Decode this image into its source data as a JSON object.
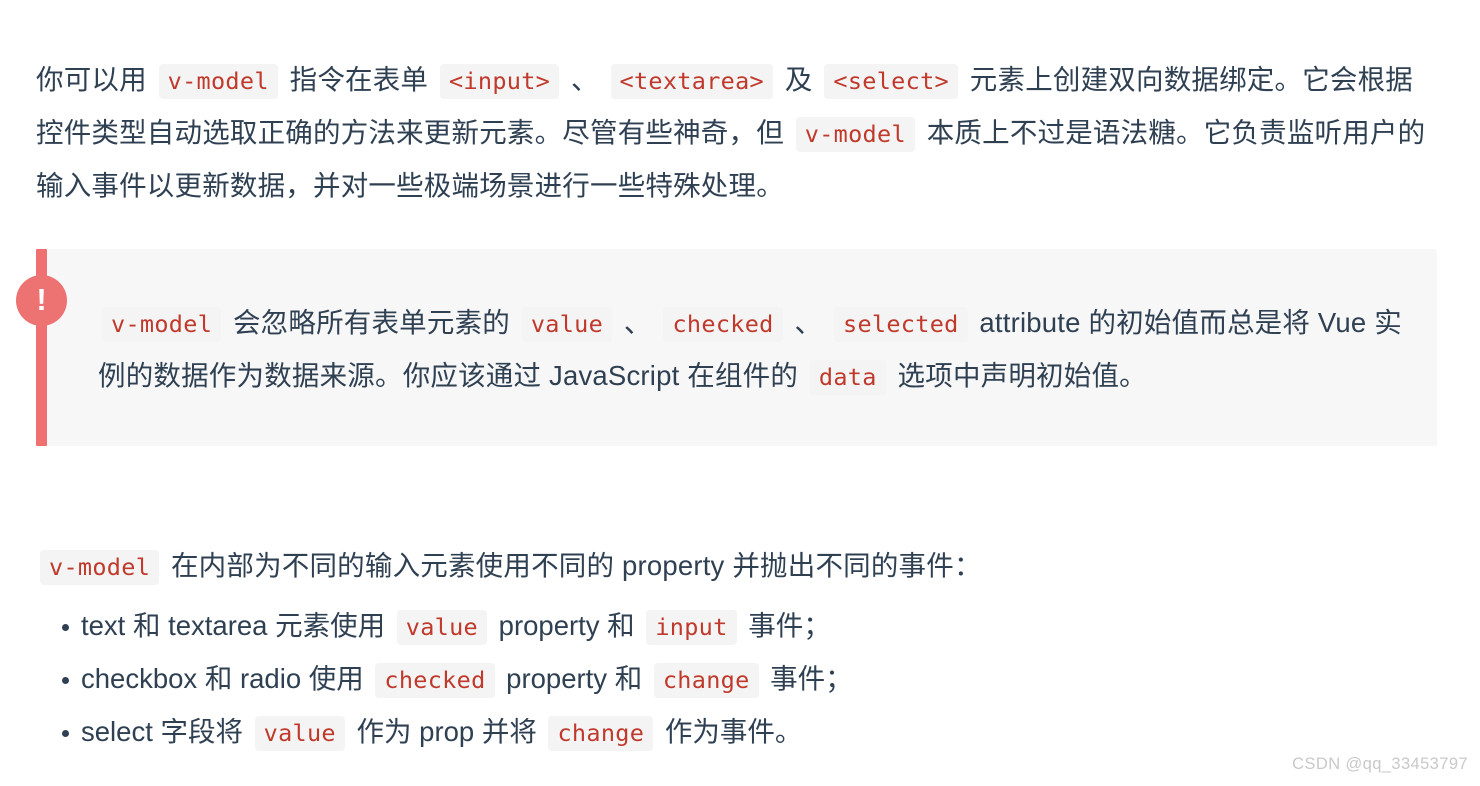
{
  "document": {
    "intro": {
      "segments": [
        {
          "type": "text",
          "value": "你可以用 "
        },
        {
          "type": "code",
          "value": "v-model"
        },
        {
          "type": "text",
          "value": " 指令在表单 "
        },
        {
          "type": "code",
          "value": "<input>"
        },
        {
          "type": "text",
          "value": " 、 "
        },
        {
          "type": "code",
          "value": "<textarea>"
        },
        {
          "type": "text",
          "value": " 及 "
        },
        {
          "type": "code",
          "value": "<select>"
        },
        {
          "type": "text",
          "value": " 元素上创建双向数据绑定。它会根据控件类型自动选取正确的方法来更新元素。尽管有些神奇，但 "
        },
        {
          "type": "code",
          "value": "v-model"
        },
        {
          "type": "text",
          "value": " 本质上不过是语法糖。它负责监听用户的输入事件以更新数据，并对一些极端场景进行一些特殊处理。"
        }
      ],
      "plain": "你可以用 v-model 指令在表单 <input> 、 <textarea> 及 <select> 元素上创建双向数据绑定。它会根据控件类型自动选取正确的方法来更新元素。尽管有些神奇，但 v-model 本质上不过是语法糖。它负责监听用户的输入事件以更新数据，并对一些极端场景进行一些特殊处理。"
    },
    "callout": {
      "icon": "exclamation-circle-icon",
      "icon_glyph": "!",
      "accent_color": "#ef7070",
      "background_color": "#f7f7f7",
      "segments": [
        {
          "type": "code",
          "value": "v-model"
        },
        {
          "type": "text",
          "value": " 会忽略所有表单元素的 "
        },
        {
          "type": "code",
          "value": "value"
        },
        {
          "type": "text",
          "value": " 、 "
        },
        {
          "type": "code",
          "value": "checked"
        },
        {
          "type": "text",
          "value": " 、 "
        },
        {
          "type": "code",
          "value": "selected"
        },
        {
          "type": "text",
          "value": " attribute 的初始值而总是将 Vue 实例的数据作为数据来源。你应该通过 JavaScript 在组件的 "
        },
        {
          "type": "code",
          "value": "data"
        },
        {
          "type": "text",
          "value": " 选项中声明初始值。"
        }
      ],
      "plain": "v-model 会忽略所有表单元素的 value 、 checked 、 selected attribute 的初始值而总是将 Vue 实例的数据作为数据来源。你应该通过 JavaScript 在组件的 data 选项中声明初始值。"
    },
    "mid_paragraph": {
      "segments": [
        {
          "type": "code",
          "value": "v-model"
        },
        {
          "type": "text",
          "value": " 在内部为不同的输入元素使用不同的 property 并抛出不同的事件："
        }
      ],
      "plain": "v-model 在内部为不同的输入元素使用不同的 property 并抛出不同的事件："
    },
    "bullets": [
      {
        "segments": [
          {
            "type": "text",
            "value": "text 和 textarea 元素使用 "
          },
          {
            "type": "code",
            "value": "value"
          },
          {
            "type": "text",
            "value": " property 和 "
          },
          {
            "type": "code",
            "value": "input"
          },
          {
            "type": "text",
            "value": " 事件；"
          }
        ],
        "plain": "text 和 textarea 元素使用 value property 和 input 事件；"
      },
      {
        "segments": [
          {
            "type": "text",
            "value": "checkbox 和 radio 使用 "
          },
          {
            "type": "code",
            "value": "checked"
          },
          {
            "type": "text",
            "value": " property 和 "
          },
          {
            "type": "code",
            "value": "change"
          },
          {
            "type": "text",
            "value": " 事件；"
          }
        ],
        "plain": "checkbox 和 radio 使用 checked property 和 change 事件；"
      },
      {
        "segments": [
          {
            "type": "text",
            "value": "select 字段将 "
          },
          {
            "type": "code",
            "value": "value"
          },
          {
            "type": "text",
            "value": " 作为 prop 并将 "
          },
          {
            "type": "code",
            "value": "change"
          },
          {
            "type": "text",
            "value": " 作为事件。"
          }
        ],
        "plain": "select 字段将 value 作为 prop 并将 change 作为事件。"
      }
    ],
    "watermark": "CSDN @qq_33453797",
    "colors": {
      "body_text": "#2f4053",
      "inline_code_text": "#c0392b",
      "inline_code_bg": "#f4f4f4",
      "callout_bg": "#f7f7f7",
      "callout_accent": "#ef7070",
      "watermark": "#c9c9c9",
      "page_bg": "#ffffff"
    }
  }
}
